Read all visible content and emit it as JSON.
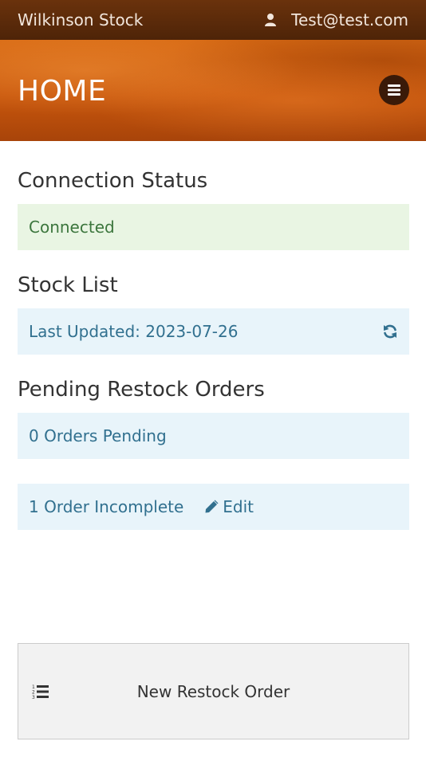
{
  "topbar": {
    "brand": "Wilkinson Stock",
    "user_email": "Test@test.com",
    "user_icon": "user-icon"
  },
  "banner": {
    "title": "HOME",
    "menu_icon": "hamburger-icon"
  },
  "connection": {
    "heading": "Connection Status",
    "status": "Connected"
  },
  "stock": {
    "heading": "Stock List",
    "last_updated": "Last Updated: 2023-07-26",
    "refresh_icon": "refresh-icon"
  },
  "orders": {
    "heading": "Pending Restock Orders",
    "pending": "0 Orders Pending",
    "incomplete": "1 Order Incomplete",
    "edit_label": "Edit",
    "edit_icon": "pencil-icon"
  },
  "new_order": {
    "label": "New Restock Order",
    "icon": "list-ol-icon"
  },
  "colors": {
    "banner": "#c8560c",
    "topbar": "#5a2a0a",
    "success_bg": "#e9f5e3",
    "success_text": "#3c763d",
    "info_bg": "#e8f4fa",
    "info_text": "#31708f"
  }
}
